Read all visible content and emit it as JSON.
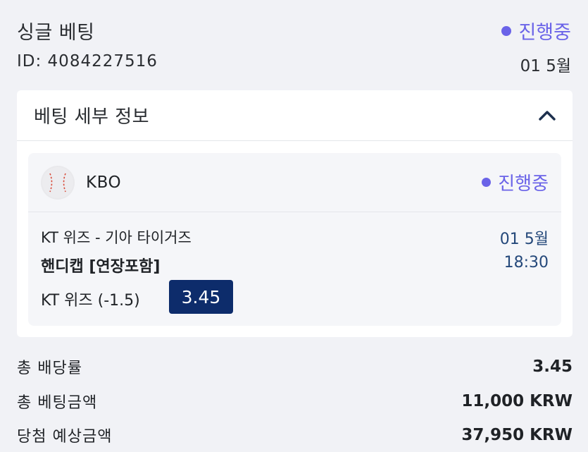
{
  "header": {
    "title": "싱글 베팅",
    "status": "진행중",
    "id_label": "ID: 4084227516",
    "date": "01 5월"
  },
  "details": {
    "title": "베팅 세부 정보",
    "collapse_icon": "chevron-up-icon",
    "match": {
      "league_icon": "baseball-icon",
      "league": "KBO",
      "status": "진행중",
      "teams": "KT 위즈 - 기아 타이거즈",
      "market": "핸디캡 [연장포함]",
      "selection": "KT 위즈 (-1.5)",
      "odds": "3.45",
      "date": "01 5월",
      "time": "18:30"
    }
  },
  "summary": {
    "total_odds_label": "총 배당률",
    "total_odds_value": "3.45",
    "total_stake_label": "총 베팅금액",
    "total_stake_value": "11,000 KRW",
    "potential_win_label": "당첨 예상금액",
    "potential_win_value": "37,950 KRW"
  },
  "colors": {
    "accent": "#6a63e8",
    "odds_badge": "#0d2c6b",
    "date_text": "#24487a",
    "background": "#f1f2f6"
  }
}
